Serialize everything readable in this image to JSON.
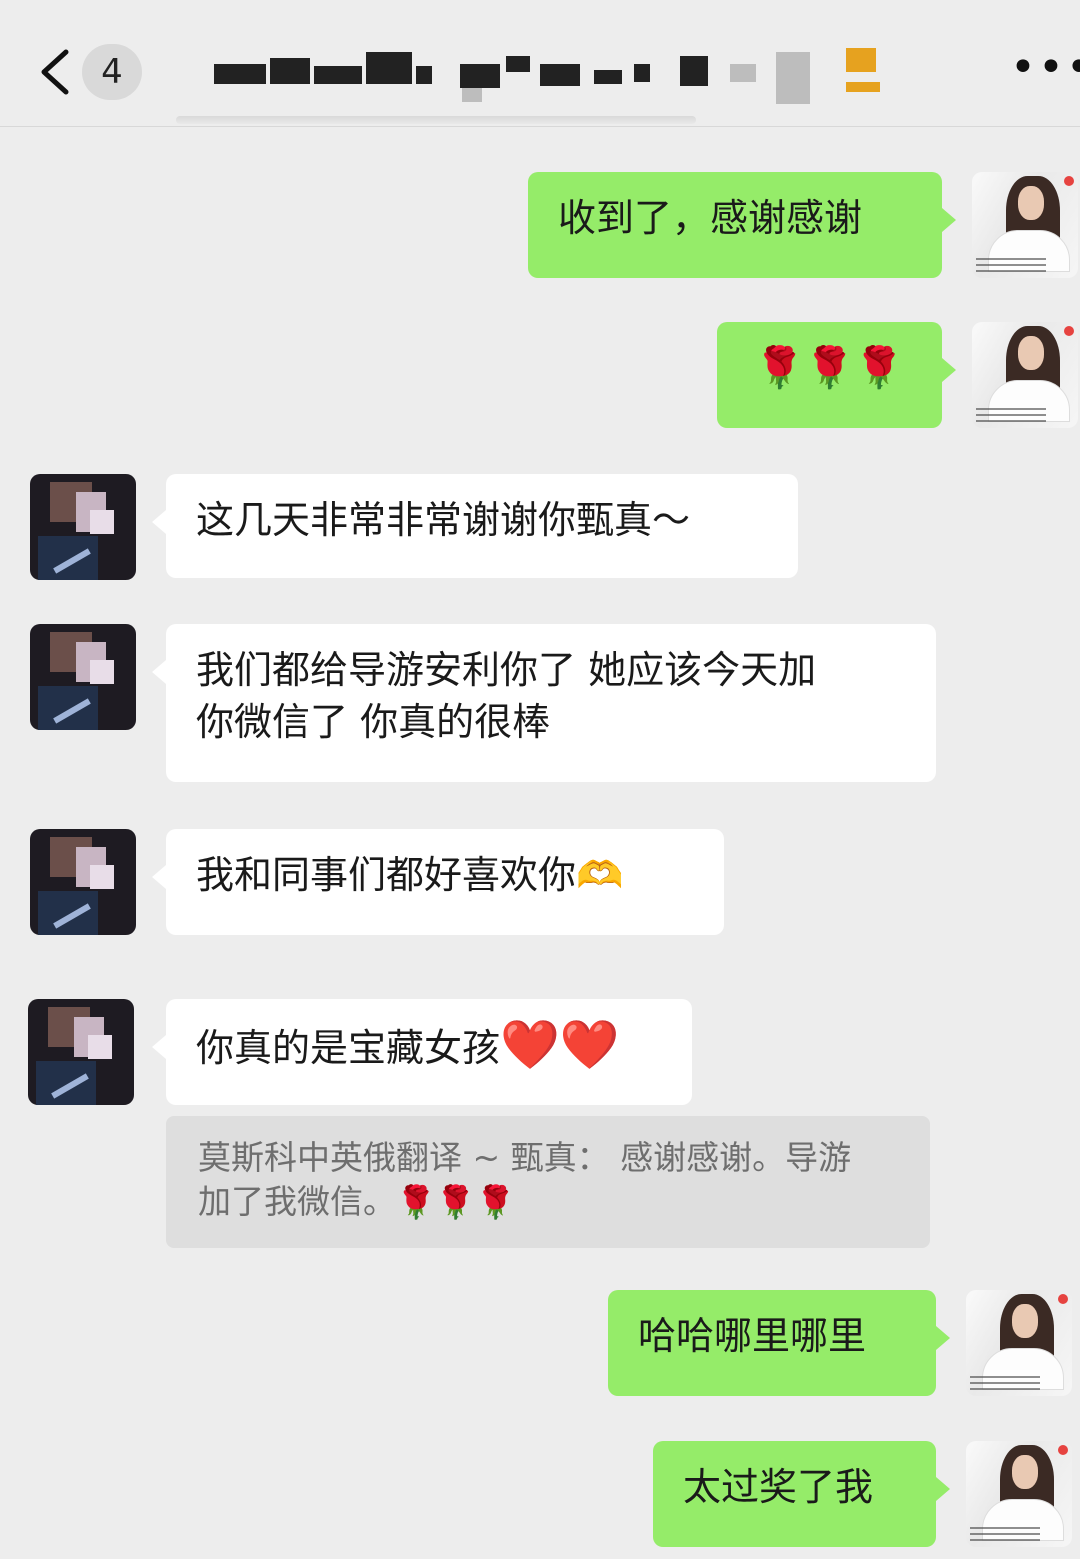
{
  "header": {
    "back_icon": "chevron-left-icon",
    "unread_count": "4",
    "more_icon": "more-dots-icon",
    "more_label": "•••"
  },
  "messages": [
    {
      "side": "me",
      "text": "收到了，感谢感谢"
    },
    {
      "side": "me",
      "text": "🌹🌹🌹"
    },
    {
      "side": "other",
      "text": "这几天非常非常谢谢你甄真～"
    },
    {
      "side": "other",
      "line1": "我们都给导游安利你了 她应该今天加",
      "line2": "你微信了 你真的很棒"
    },
    {
      "side": "other",
      "text": "我和同事们都好喜欢你",
      "emoji": "🫶"
    },
    {
      "side": "other",
      "text": "你真的是宝藏女孩",
      "emoji": "❤️❤️"
    },
    {
      "side": "me",
      "text": "哈哈哪里哪里"
    },
    {
      "side": "me",
      "text": "太过奖了我"
    }
  ],
  "quote": {
    "line1": "莫斯科中英俄翻译 ~ 甄真： 感谢感谢。导游",
    "line2": "加了我微信。",
    "emoji": "🌹🌹🌹"
  },
  "colors": {
    "background": "#ededed",
    "my_bubble": "#95ec69",
    "their_bubble": "#ffffff",
    "quote_bg": "#dedede"
  }
}
